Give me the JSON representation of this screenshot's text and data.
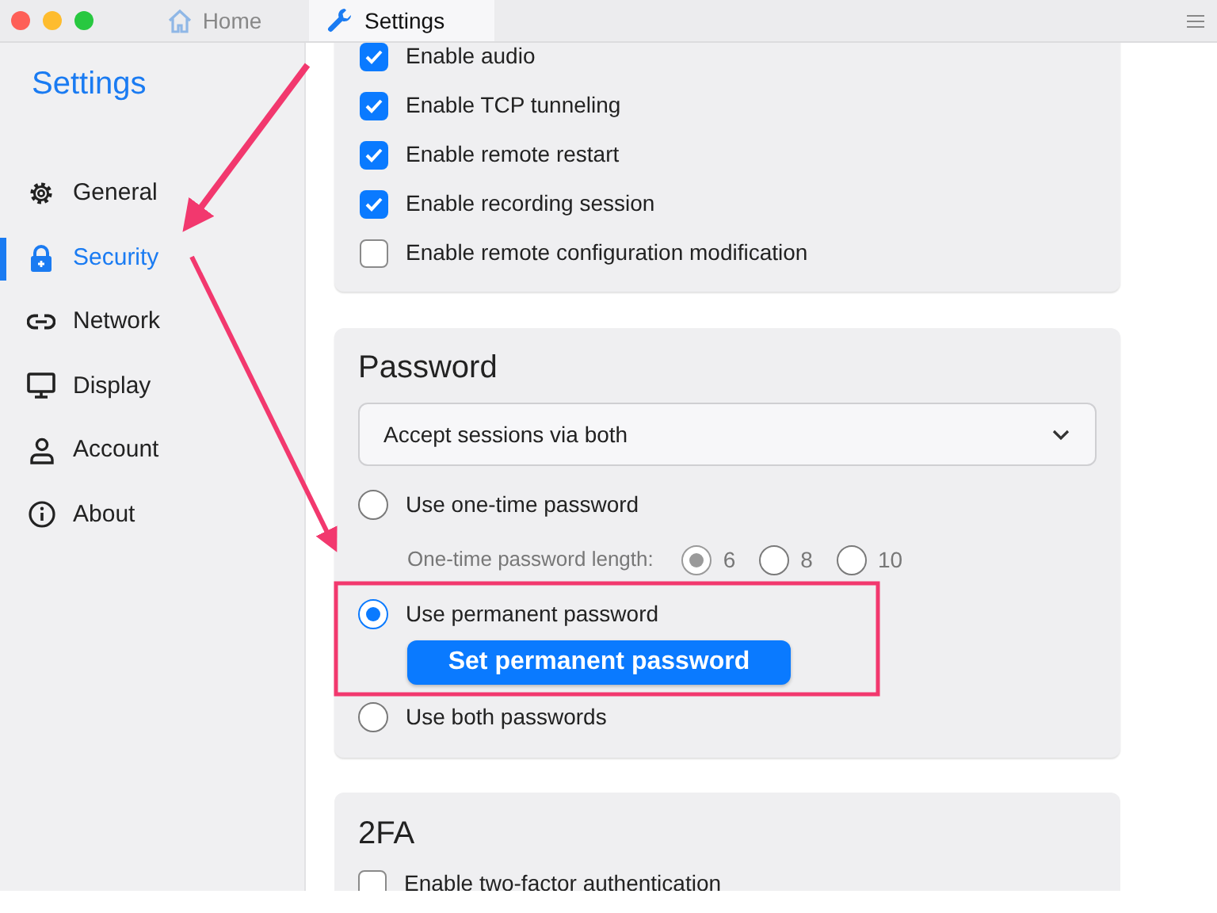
{
  "tabs": [
    {
      "label": "Home",
      "selected": false
    },
    {
      "label": "Settings",
      "selected": true
    }
  ],
  "sidebar": {
    "title": "Settings",
    "items": [
      {
        "label": "General",
        "selected": false
      },
      {
        "label": "Security",
        "selected": true
      },
      {
        "label": "Network",
        "selected": false
      },
      {
        "label": "Display",
        "selected": false
      },
      {
        "label": "Account",
        "selected": false
      },
      {
        "label": "About",
        "selected": false
      }
    ]
  },
  "permissions": [
    {
      "label": "Enable audio",
      "checked": true
    },
    {
      "label": "Enable TCP tunneling",
      "checked": true
    },
    {
      "label": "Enable remote restart",
      "checked": true
    },
    {
      "label": "Enable recording session",
      "checked": true
    },
    {
      "label": "Enable remote configuration modification",
      "checked": false
    }
  ],
  "password": {
    "title": "Password",
    "approval_mode": "Accept sessions via both",
    "options": [
      {
        "label": "Use one-time password",
        "selected": false,
        "length": {
          "label": "One-time password length:",
          "disabled": true,
          "choices": [
            {
              "label": "6",
              "selected": true
            },
            {
              "label": "8",
              "selected": false
            },
            {
              "label": "10",
              "selected": false
            }
          ]
        }
      },
      {
        "label": "Use permanent password",
        "selected": true,
        "button": "Set permanent password"
      },
      {
        "label": "Use both passwords",
        "selected": false
      }
    ]
  },
  "two_factor": {
    "title": "2FA",
    "items": [
      {
        "label": "Enable two-factor authentication",
        "checked": false
      }
    ]
  }
}
